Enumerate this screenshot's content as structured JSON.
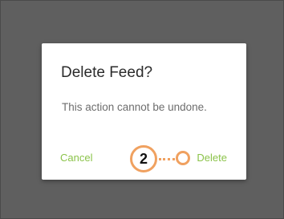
{
  "dialog": {
    "title": "Delete Feed?",
    "message": "This action cannot be undone.",
    "cancel_label": "Cancel",
    "delete_label": "Delete"
  },
  "annotation": {
    "step_number": "2"
  },
  "colors": {
    "backdrop": "#5f5f5f",
    "dialog_background": "#ffffff",
    "action_text": "#8bc34a",
    "callout": "#f0a160"
  }
}
